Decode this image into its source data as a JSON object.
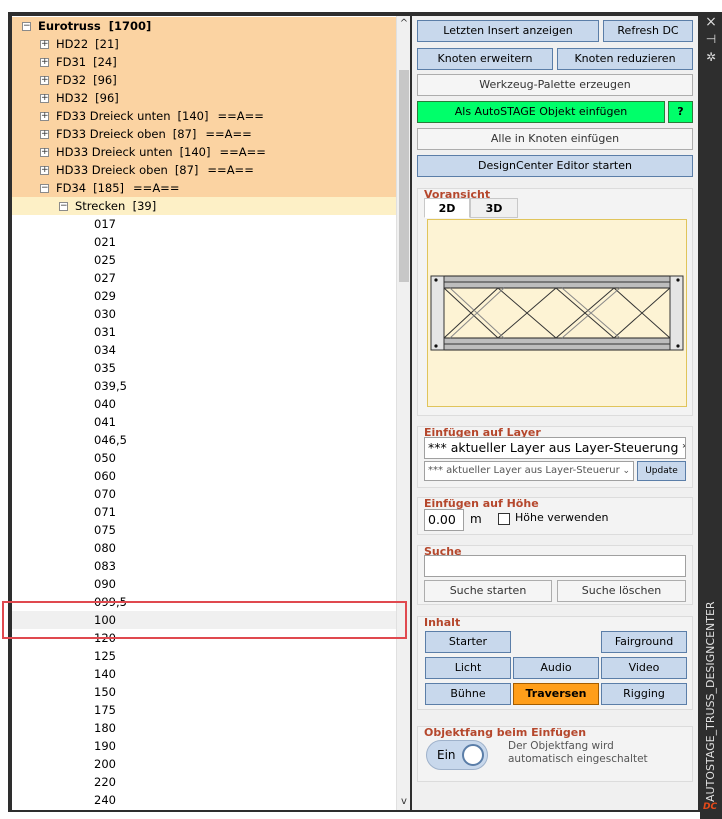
{
  "tree": {
    "root": {
      "label": "Eurotruss",
      "count": "[1700]"
    },
    "groups": [
      {
        "label": "HD22",
        "count": "[21]",
        "suffix": ""
      },
      {
        "label": "FD31",
        "count": "[24]",
        "suffix": ""
      },
      {
        "label": "FD32",
        "count": "[96]",
        "suffix": ""
      },
      {
        "label": "HD32",
        "count": "[96]",
        "suffix": ""
      },
      {
        "label": "FD33 Dreieck unten",
        "count": "[140]",
        "suffix": "==A=="
      },
      {
        "label": "FD33 Dreieck oben",
        "count": "[87]",
        "suffix": "==A=="
      },
      {
        "label": "HD33 Dreieck unten",
        "count": "[140]",
        "suffix": "==A=="
      },
      {
        "label": "HD33 Dreieck oben",
        "count": "[87]",
        "suffix": "==A=="
      },
      {
        "label": "FD34",
        "count": "[185]",
        "suffix": "==A=="
      }
    ],
    "subgroup": {
      "label": "Strecken",
      "count": "[39]"
    },
    "leaves": [
      "017",
      "021",
      "025",
      "027",
      "029",
      "030",
      "031",
      "034",
      "035",
      "039,5",
      "040",
      "041",
      "046,5",
      "050",
      "060",
      "070",
      "071",
      "075",
      "080",
      "083",
      "090",
      "099,5",
      "100",
      "120",
      "125",
      "140",
      "150",
      "175",
      "180",
      "190",
      "200",
      "220",
      "240"
    ],
    "expand_plus": "+",
    "expand_minus": "−"
  },
  "scrollbar": {
    "up": "^",
    "down": "v"
  },
  "buttons": {
    "last_insert": "Letzten Insert anzeigen",
    "refresh_dc": "Refresh DC",
    "expand_nodes": "Knoten erweitern",
    "reduce_nodes": "Knoten reduzieren",
    "tool_palette": "Werkzeug-Palette erzeugen",
    "insert_autostage": "Als AutoSTAGE Objekt einfügen",
    "help": "?",
    "insert_all": "Alle in Knoten einfügen",
    "designcenter": "DesignCenter Editor starten"
  },
  "preview": {
    "title": "Voransicht",
    "tabs": [
      "2D",
      "3D"
    ],
    "active_tab": "2D"
  },
  "layer": {
    "title": "Einfügen auf Layer",
    "current": "*** aktueller Layer aus Layer-Steuerung ***",
    "select_value": "*** aktueller Layer aus Layer-Steuerur",
    "update": "Update"
  },
  "height": {
    "title": "Einfügen auf Höhe",
    "value": "0.00",
    "unit": "m",
    "checkbox_label": "Höhe verwenden"
  },
  "search": {
    "title": "Suche",
    "value": "",
    "start": "Suche starten",
    "clear": "Suche löschen"
  },
  "content": {
    "title": "Inhalt",
    "buttons": [
      "Starter",
      "Fairground",
      "Licht",
      "Audio",
      "Video",
      "Bühne",
      "Traversen",
      "Rigging"
    ],
    "active": "Traversen"
  },
  "snap": {
    "title": "Objektfang beim Einfügen",
    "toggle": "Ein",
    "desc_line1": "Der Objektfang wird",
    "desc_line2": "automatisch eingeschaltet"
  },
  "sidebar": {
    "title": "AUTOSTAGE_TRUSS_DESIGNCENTER",
    "close": "×",
    "pin": "⊣",
    "settings": "✲",
    "logo": "DC"
  },
  "colors": {
    "highlight": "#fbd3a2",
    "subhighlight": "#fdf0c6",
    "green": "#00ff6a",
    "orange": "#ff9e1a",
    "accent_title": "#b5472c"
  }
}
